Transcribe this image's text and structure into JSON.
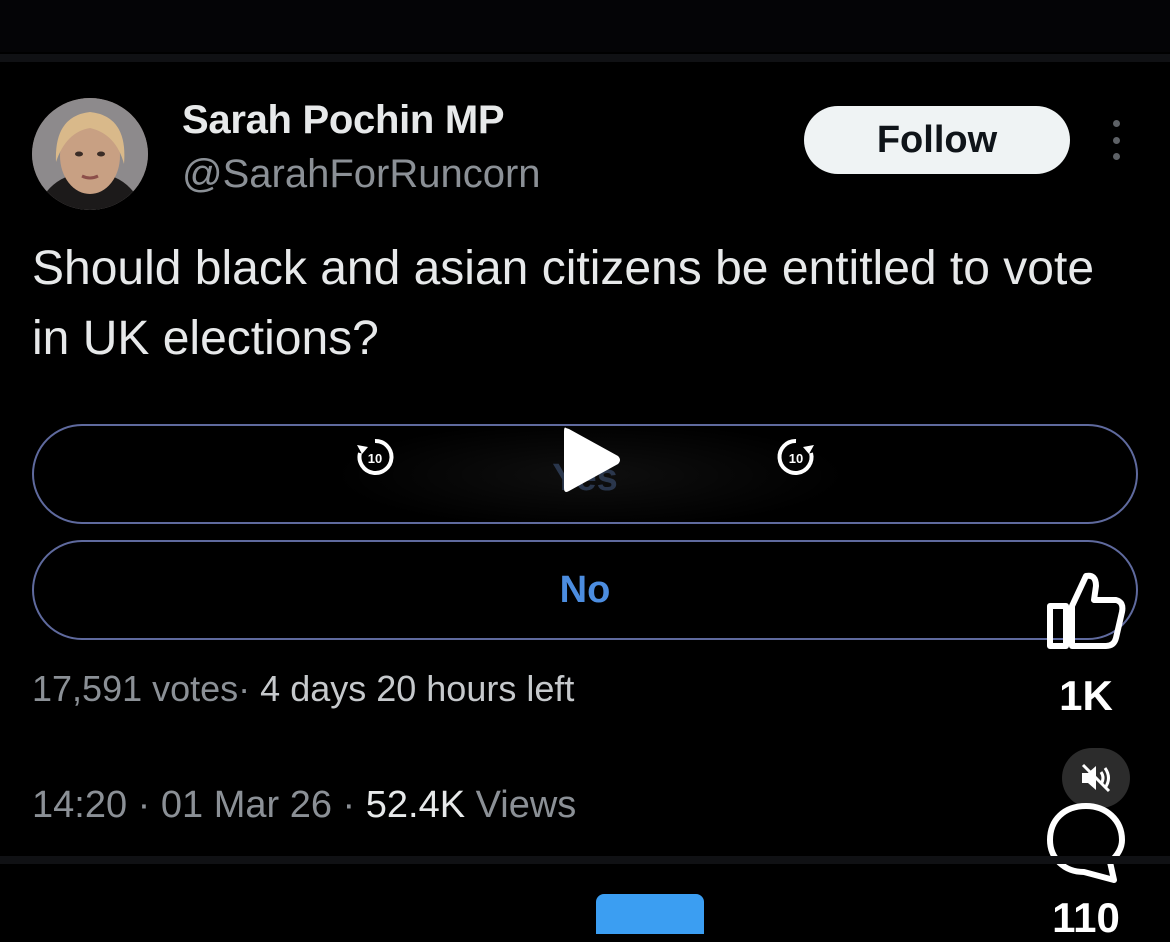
{
  "author": {
    "display_name": "Sarah Pochin MP",
    "handle": "@SarahForRuncorn"
  },
  "follow_label": "Follow",
  "tweet": {
    "text": "Should black and asian citizens be entitled to vote in UK elections?"
  },
  "poll": {
    "options": [
      {
        "label": "Yes"
      },
      {
        "label": "No"
      }
    ],
    "votes": "17,591 votes",
    "separator": "·",
    "time_left": "4 days 20 hours left"
  },
  "meta": {
    "time": "14:20",
    "sep1": "·",
    "date": "01 Mar 26",
    "sep2": "·",
    "views_count": "52.4K",
    "views_label": "Views"
  },
  "video_controls": {
    "rewind_label": "10",
    "forward_label": "10"
  },
  "side_actions": {
    "like_count": "1K",
    "comment_count": "110"
  },
  "colors": {
    "accent": "#4c8de0",
    "poll_border": "#5f6a9e",
    "follow_bg": "#eff3f4",
    "tab_blue": "#3b9ef2"
  }
}
